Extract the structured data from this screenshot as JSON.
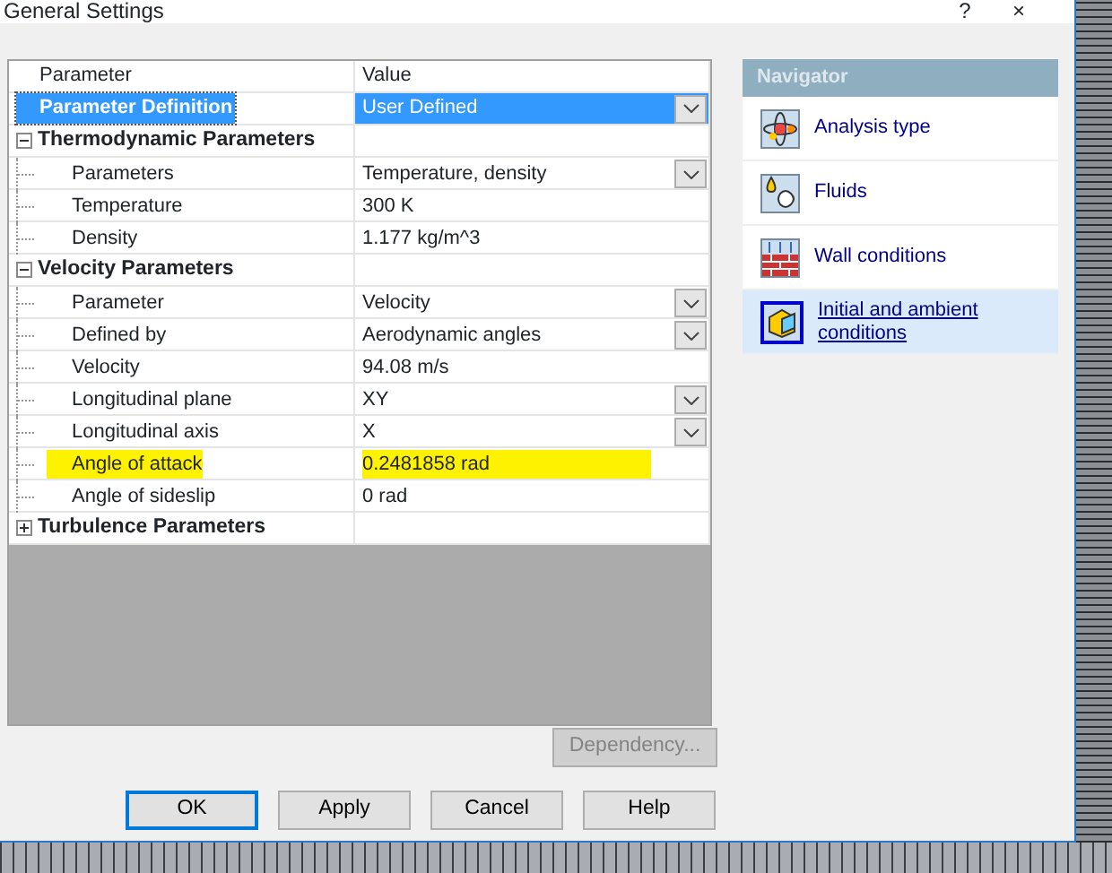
{
  "window": {
    "title": "General Settings",
    "controls": [
      "?",
      "×"
    ]
  },
  "table": {
    "columns": [
      "Parameter",
      "Value"
    ],
    "rows": [
      {
        "kind": "property",
        "name": "Parameter Definition",
        "value": "User Defined",
        "dropdown": true,
        "selected": true,
        "highlighted": false
      },
      {
        "kind": "group",
        "label": "Thermodynamic Parameters",
        "expanded": true,
        "children": [
          {
            "kind": "property",
            "name": "Parameters",
            "value": "Temperature, density",
            "dropdown": true,
            "selected": false,
            "highlighted": false
          },
          {
            "kind": "property",
            "name": "Temperature",
            "value": "300 K",
            "dropdown": false,
            "selected": false,
            "highlighted": false
          },
          {
            "kind": "property",
            "name": "Density",
            "value": "1.177 kg/m^3",
            "dropdown": false,
            "selected": false,
            "highlighted": false
          }
        ]
      },
      {
        "kind": "group",
        "label": "Velocity Parameters",
        "expanded": true,
        "children": [
          {
            "kind": "property",
            "name": "Parameter",
            "value": "Velocity",
            "dropdown": true,
            "selected": false,
            "highlighted": false
          },
          {
            "kind": "property",
            "name": "Defined by",
            "value": "Aerodynamic angles",
            "dropdown": true,
            "selected": false,
            "highlighted": false
          },
          {
            "kind": "property",
            "name": "Velocity",
            "value": "94.08 m/s",
            "dropdown": false,
            "selected": false,
            "highlighted": false
          },
          {
            "kind": "property",
            "name": "Longitudinal plane",
            "value": "XY",
            "dropdown": true,
            "selected": false,
            "highlighted": false
          },
          {
            "kind": "property",
            "name": "Longitudinal axis",
            "value": "X",
            "dropdown": true,
            "selected": false,
            "highlighted": false
          },
          {
            "kind": "property",
            "name": "Angle of attack",
            "value": "0.2481858 rad",
            "dropdown": false,
            "selected": false,
            "highlighted": true
          },
          {
            "kind": "property",
            "name": "Angle of sideslip",
            "value": "0 rad",
            "dropdown": false,
            "selected": false,
            "highlighted": false
          }
        ]
      },
      {
        "kind": "group",
        "label": "Turbulence Parameters",
        "expanded": false,
        "children": []
      }
    ]
  },
  "navigator": {
    "title": "Navigator",
    "items": [
      {
        "kind": "analysis",
        "label": "Analysis type",
        "selected": false
      },
      {
        "kind": "fluids",
        "label": "Fluids",
        "selected": false
      },
      {
        "kind": "wall",
        "label": "Wall conditions",
        "selected": false
      },
      {
        "kind": "initial",
        "label": "Initial and ambient conditions",
        "selected": true
      }
    ]
  },
  "dependency_button": {
    "label": "Dependency...",
    "disabled": true
  },
  "buttons": [
    {
      "label": "OK",
      "default": true
    },
    {
      "label": "Apply",
      "default": false
    },
    {
      "label": "Cancel",
      "default": false
    },
    {
      "label": "Help",
      "default": false
    }
  ]
}
